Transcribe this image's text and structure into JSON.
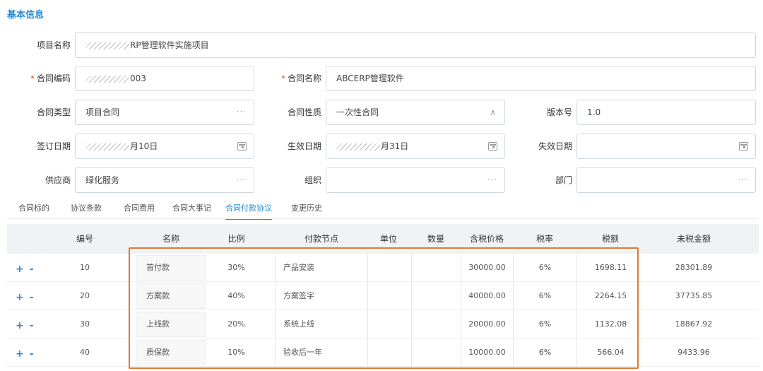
{
  "section_title": "基本信息",
  "form": {
    "project_name": {
      "label": "项目名称",
      "value": "RP管理软件实施项目"
    },
    "contract_code": {
      "label": "合同编码",
      "value": "003"
    },
    "contract_name": {
      "label": "合同名称",
      "value": "ABCERP管理软件"
    },
    "contract_type": {
      "label": "合同类型",
      "value": "项目合同"
    },
    "contract_nature": {
      "label": "合同性质",
      "value": "一次性合同"
    },
    "version": {
      "label": "版本号",
      "value": "1.0"
    },
    "sign_date": {
      "label": "签订日期",
      "value": "月10日"
    },
    "effective_date": {
      "label": "生效日期",
      "value": "月31日"
    },
    "expire_date": {
      "label": "失效日期",
      "value": ""
    },
    "supplier": {
      "label": "供应商",
      "value": "绿化服务"
    },
    "org": {
      "label": "组织",
      "value": ""
    },
    "dept": {
      "label": "部门",
      "value": ""
    },
    "required_mark": "*",
    "dots": "···",
    "chevron": "∧"
  },
  "tabs": [
    {
      "label": "合同标的"
    },
    {
      "label": "协议条款"
    },
    {
      "label": "合同费用"
    },
    {
      "label": "合同大事记"
    },
    {
      "label": "合同付款协议"
    },
    {
      "label": "变更历史"
    }
  ],
  "table": {
    "columns": [
      "编号",
      "名称",
      "比例",
      "付款节点",
      "单位",
      "数量",
      "含税价格",
      "税率",
      "税额",
      "未税金额"
    ],
    "op_add": "+",
    "op_remove": "-",
    "rows": [
      {
        "no": "10",
        "name": "首付款",
        "ratio": "30%",
        "node": "产品安装",
        "unit": "",
        "qty": "",
        "price": "30000.00",
        "rate": "6%",
        "tax": "1698.11",
        "net": "28301.89"
      },
      {
        "no": "20",
        "name": "方案款",
        "ratio": "40%",
        "node": "方案签字",
        "unit": "",
        "qty": "",
        "price": "40000.00",
        "rate": "6%",
        "tax": "2264.15",
        "net": "37735.85"
      },
      {
        "no": "30",
        "name": "上线款",
        "ratio": "20%",
        "node": "系统上线",
        "unit": "",
        "qty": "",
        "price": "20000.00",
        "rate": "6%",
        "tax": "1132.08",
        "net": "18867.92"
      },
      {
        "no": "40",
        "name": "质保款",
        "ratio": "10%",
        "node": "验收后一年",
        "unit": "",
        "qty": "",
        "price": "10000.00",
        "rate": "6%",
        "tax": "566.04",
        "net": "9433.96"
      }
    ]
  },
  "colors": {
    "accent": "#2a8ad4",
    "required": "#e74c3c",
    "highlight": "#e07a35"
  },
  "icons": {
    "date": "calendar-icon",
    "lookup": "more-dots-icon",
    "dropdown": "chevron-up-icon"
  }
}
